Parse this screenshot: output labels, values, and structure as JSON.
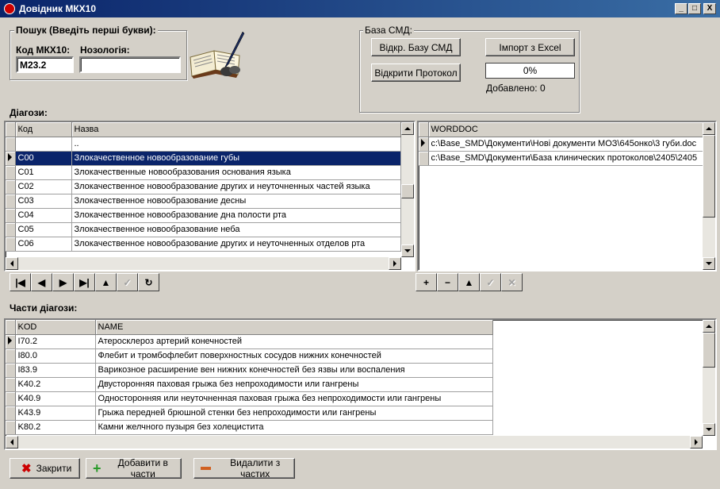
{
  "window": {
    "title": "Довідник МКХ10",
    "controls": [
      "_",
      "□",
      "X"
    ]
  },
  "search": {
    "group_label": "Пошук (Введіть перші букви):",
    "code_label": "Код МКХ10:",
    "code_value": "M23.2",
    "nosology_label": "Нозологія:",
    "nosology_value": ""
  },
  "smd": {
    "group_label": "База СМД:",
    "open_db_label": "Відкр. Базу СМД",
    "import_label": "Імпорт з Excel",
    "open_protocol_label": "Відкрити Протокол",
    "progress_text": "0%",
    "progress": 0,
    "added_label": "Добавлено: 0"
  },
  "diagnoses": {
    "label": "Діагози:",
    "columns": [
      "Код",
      "Назва"
    ],
    "rows": [
      [
        "",
        ".."
      ],
      [
        "C00",
        "Злокачественное новообразование губы"
      ],
      [
        "C01",
        "Злокачественные новообразования основания языка"
      ],
      [
        "C02",
        "Злокачественное новообразование других и неуточненных частей языка"
      ],
      [
        "C03",
        "Злокачественное новообразование десны"
      ],
      [
        "C04",
        "Злокачественное новообразование дна полости рта"
      ],
      [
        "C05",
        "Злокачественное новообразование неба"
      ],
      [
        "C06",
        "Злокачественное новообразование других и неуточненных отделов рта"
      ]
    ],
    "selected_row": 1
  },
  "worddoc": {
    "columns": [
      "WORDDOC"
    ],
    "rows": [
      [
        "c:\\Base_SMD\\Документи\\Нові документи МОЗ\\645онко\\3 губи.doc"
      ],
      [
        "c:\\Base_SMD\\Документи\\База клинических протоколов\\2405\\2405"
      ]
    ]
  },
  "nav_left": [
    "|◀",
    "◀",
    "▶",
    "▶|",
    "▲",
    "✓",
    "↻"
  ],
  "nav_right": [
    "+",
    "−",
    "▲",
    "✓",
    "✕"
  ],
  "parts": {
    "label": "Части діагози:",
    "columns": [
      "KOD",
      "NAME"
    ],
    "rows": [
      [
        "I70.2",
        "Атеросклероз артерий конечностей"
      ],
      [
        "I80.0",
        "Флебит и тромбофлебит поверхностных сосудов нижних конечностей"
      ],
      [
        "I83.9",
        "Варикозное расширение вен нижних конечностей без язвы или воспаления"
      ],
      [
        "K40.2",
        "Двусторонняя паховая грыжа без непроходимости или гангрены"
      ],
      [
        "K40.9",
        "Односторонняя или неуточненная паховая грыжа без непроходимости или гангрены"
      ],
      [
        "K43.9",
        "Грыжа передней брюшной стенки без непроходимости или гангрены"
      ],
      [
        "K80.2",
        "Камни желчного пузыря без холецистита"
      ]
    ]
  },
  "footer": {
    "close_label": "Закрити",
    "add_label": "Добавити в части",
    "remove_label": "Видалити з частих"
  }
}
